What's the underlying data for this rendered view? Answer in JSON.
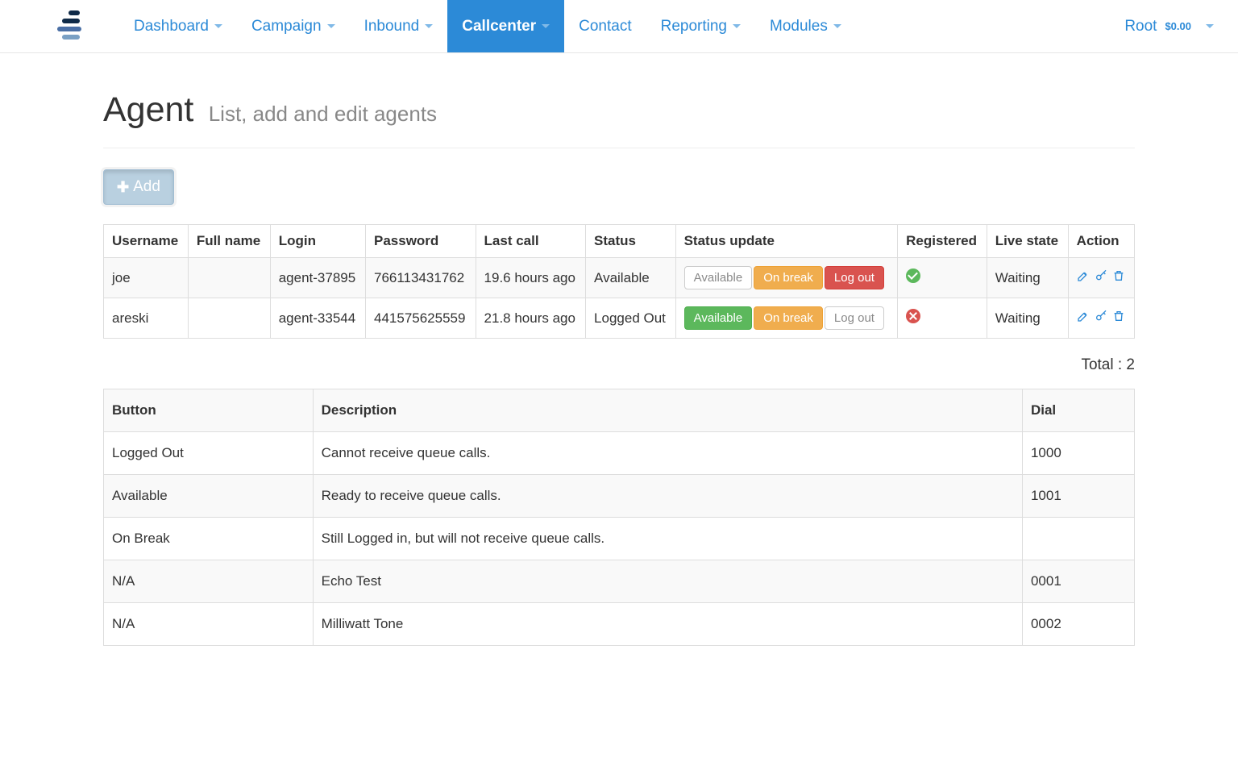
{
  "nav": {
    "items": [
      {
        "label": "Dashboard",
        "caret": true,
        "active": false
      },
      {
        "label": "Campaign",
        "caret": true,
        "active": false
      },
      {
        "label": "Inbound",
        "caret": true,
        "active": false
      },
      {
        "label": "Callcenter",
        "caret": true,
        "active": true
      },
      {
        "label": "Contact",
        "caret": false,
        "active": false
      },
      {
        "label": "Reporting",
        "caret": true,
        "active": false
      },
      {
        "label": "Modules",
        "caret": true,
        "active": false
      }
    ],
    "user": "Root",
    "amount": "$0.00"
  },
  "page": {
    "title": "Agent",
    "subtitle": "List, add and edit agents",
    "add_label": "Add"
  },
  "agents": {
    "columns": [
      "Username",
      "Full name",
      "Login",
      "Password",
      "Last call",
      "Status",
      "Status update",
      "Registered",
      "Live state",
      "Action"
    ],
    "rows": [
      {
        "username": "joe",
        "fullname": "",
        "login": "agent-37895",
        "password": "766113431762",
        "last_call": "19.6 hours ago",
        "status": "Available",
        "update_buttons": [
          {
            "label": "Available",
            "style": "default"
          },
          {
            "label": "On break",
            "style": "warning"
          },
          {
            "label": "Log out",
            "style": "danger"
          }
        ],
        "registered": true,
        "live_state": "Waiting"
      },
      {
        "username": "areski",
        "fullname": "",
        "login": "agent-33544",
        "password": "441575625559",
        "last_call": "21.8 hours ago",
        "status": "Logged Out",
        "update_buttons": [
          {
            "label": "Available",
            "style": "success"
          },
          {
            "label": "On break",
            "style": "warning"
          },
          {
            "label": "Log out",
            "style": "default"
          }
        ],
        "registered": false,
        "live_state": "Waiting"
      }
    ],
    "total_label": "Total :",
    "total_count": "2"
  },
  "legend": {
    "columns": [
      "Button",
      "Description",
      "Dial"
    ],
    "rows": [
      {
        "button": "Logged Out",
        "desc": "Cannot receive queue calls.",
        "dial": "1000"
      },
      {
        "button": "Available",
        "desc": "Ready to receive queue calls.",
        "dial": "1001"
      },
      {
        "button": "On Break",
        "desc": "Still Logged in, but will not receive queue calls.",
        "dial": ""
      },
      {
        "button": "N/A",
        "desc": "Echo Test",
        "dial": "0001"
      },
      {
        "button": "N/A",
        "desc": "Milliwatt Tone",
        "dial": "0002"
      }
    ]
  }
}
